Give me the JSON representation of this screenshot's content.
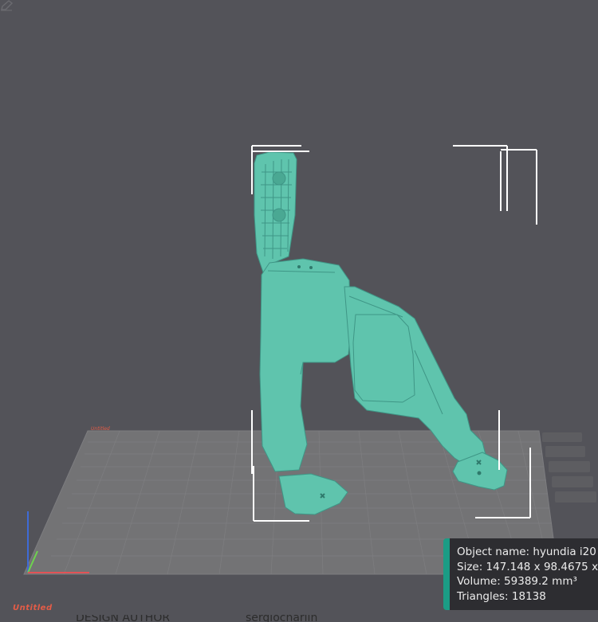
{
  "app": {
    "colors": {
      "background": "#535359",
      "plate": "#737375",
      "model": "#5fc4ad",
      "accent": "#1b9c85",
      "plate_label": "#e35c47"
    }
  },
  "viewport": {
    "mini_plate_label": "Untitled"
  },
  "plate": {
    "name": "Untitled",
    "edit_icon": "pencil-icon"
  },
  "object_info": {
    "name_line": "Object name: hyundia i20",
    "size_line": "Size: 147.148 x 98.4675 x",
    "volume_line": "Volume: 59389.2 mm³",
    "triangles_line": "Triangles: 18138"
  },
  "bottom_bar": {
    "label": "DESIGN AUTHOR",
    "value": "sergiocharlin"
  }
}
